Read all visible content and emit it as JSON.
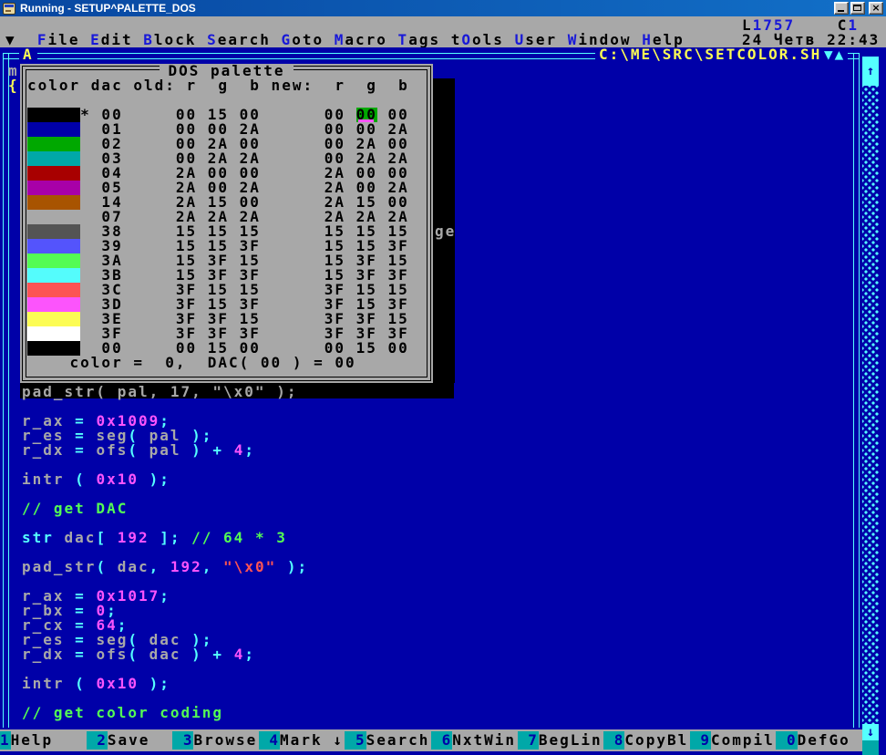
{
  "titlebar": {
    "title": "Running - SETUP^PALETTE_DOS"
  },
  "status": {
    "line1": [
      [
        "L",
        "k"
      ],
      [
        "1757",
        "b"
      ],
      [
        "    ",
        "k"
      ],
      [
        "C",
        "k"
      ],
      [
        "1",
        "b"
      ]
    ],
    "datetime": "24 Четв 22:43"
  },
  "menu": {
    "arrow": "▼",
    "items": [
      {
        "pre": "",
        "hot": "F",
        "post": "ile"
      },
      {
        "pre": "",
        "hot": "E",
        "post": "dit"
      },
      {
        "pre": "",
        "hot": "B",
        "post": "lock"
      },
      {
        "pre": "",
        "hot": "S",
        "post": "earch"
      },
      {
        "pre": "",
        "hot": "G",
        "post": "oto"
      },
      {
        "pre": "",
        "hot": "M",
        "post": "acro"
      },
      {
        "pre": "",
        "hot": "T",
        "post": "ags"
      },
      {
        "pre": "t",
        "hot": "O",
        "post": "ols"
      },
      {
        "pre": "",
        "hot": "U",
        "post": "ser"
      },
      {
        "pre": "",
        "hot": "W",
        "post": "indow"
      },
      {
        "pre": "",
        "hot": "H",
        "post": "elp"
      }
    ]
  },
  "editor": {
    "window_tag": "A",
    "file_path": "C:\\ME\\SRC\\SETCOLOR.SH",
    "collapse_icons": "▼▲",
    "scroll_up_icon": "↑",
    "scroll_down_icon": "↓",
    "fragment_left_1": "m",
    "fragment_left_2": "{",
    "fragment_shadow": "ge"
  },
  "dialog": {
    "title": "DOS palette",
    "header": "color dac old: r  g  b new:  r  g  b",
    "footer": "    color =  0,  DAC( 00 ) = 00",
    "rows": [
      {
        "swatch": "#000000",
        "marker": "*",
        "dac": "00",
        "old": [
          "00",
          "15",
          "00"
        ],
        "new": [
          "00",
          "00",
          "00"
        ],
        "hl": true
      },
      {
        "swatch": "#0000A8",
        "marker": "",
        "dac": "01",
        "old": [
          "00",
          "00",
          "2A"
        ],
        "new": [
          "00",
          "00",
          "2A"
        ]
      },
      {
        "swatch": "#00A800",
        "marker": "",
        "dac": "02",
        "old": [
          "00",
          "2A",
          "00"
        ],
        "new": [
          "00",
          "2A",
          "00"
        ]
      },
      {
        "swatch": "#00A8A8",
        "marker": "",
        "dac": "03",
        "old": [
          "00",
          "2A",
          "2A"
        ],
        "new": [
          "00",
          "2A",
          "2A"
        ]
      },
      {
        "swatch": "#A80000",
        "marker": "",
        "dac": "04",
        "old": [
          "2A",
          "00",
          "00"
        ],
        "new": [
          "2A",
          "00",
          "00"
        ]
      },
      {
        "swatch": "#A800A8",
        "marker": "",
        "dac": "05",
        "old": [
          "2A",
          "00",
          "2A"
        ],
        "new": [
          "2A",
          "00",
          "2A"
        ]
      },
      {
        "swatch": "#A85400",
        "marker": "",
        "dac": "14",
        "old": [
          "2A",
          "15",
          "00"
        ],
        "new": [
          "2A",
          "15",
          "00"
        ]
      },
      {
        "swatch": "#A8A8A8",
        "marker": "",
        "dac": "07",
        "old": [
          "2A",
          "2A",
          "2A"
        ],
        "new": [
          "2A",
          "2A",
          "2A"
        ]
      },
      {
        "swatch": "#545454",
        "marker": "",
        "dac": "38",
        "old": [
          "15",
          "15",
          "15"
        ],
        "new": [
          "15",
          "15",
          "15"
        ]
      },
      {
        "swatch": "#5454FC",
        "marker": "",
        "dac": "39",
        "old": [
          "15",
          "15",
          "3F"
        ],
        "new": [
          "15",
          "15",
          "3F"
        ]
      },
      {
        "swatch": "#54FC54",
        "marker": "",
        "dac": "3A",
        "old": [
          "15",
          "3F",
          "15"
        ],
        "new": [
          "15",
          "3F",
          "15"
        ]
      },
      {
        "swatch": "#54FCFC",
        "marker": "",
        "dac": "3B",
        "old": [
          "15",
          "3F",
          "3F"
        ],
        "new": [
          "15",
          "3F",
          "3F"
        ]
      },
      {
        "swatch": "#FC5454",
        "marker": "",
        "dac": "3C",
        "old": [
          "3F",
          "15",
          "15"
        ],
        "new": [
          "3F",
          "15",
          "15"
        ]
      },
      {
        "swatch": "#FC54FC",
        "marker": "",
        "dac": "3D",
        "old": [
          "3F",
          "15",
          "3F"
        ],
        "new": [
          "3F",
          "15",
          "3F"
        ]
      },
      {
        "swatch": "#FCFC54",
        "marker": "",
        "dac": "3E",
        "old": [
          "3F",
          "3F",
          "15"
        ],
        "new": [
          "3F",
          "3F",
          "15"
        ]
      },
      {
        "swatch": "#FFFFFF",
        "marker": "",
        "dac": "3F",
        "old": [
          "3F",
          "3F",
          "3F"
        ],
        "new": [
          "3F",
          "3F",
          "3F"
        ]
      },
      {
        "swatch": "#000000",
        "marker": "",
        "dac": "00",
        "old": [
          "00",
          "15",
          "00"
        ],
        "new": [
          "00",
          "15",
          "00"
        ]
      }
    ]
  },
  "code": {
    "lines": [
      {
        "marked": true,
        "tokens": [
          [
            "pad_str( pal, 17, \"\\x0\" );",
            "m"
          ]
        ]
      },
      {
        "tokens": []
      },
      {
        "tokens": [
          [
            "r_ax ",
            "i"
          ],
          [
            "= ",
            "o"
          ],
          [
            "0x1009",
            "n"
          ],
          [
            ";",
            "o"
          ]
        ]
      },
      {
        "tokens": [
          [
            "r_es ",
            "i"
          ],
          [
            "= ",
            "o"
          ],
          [
            "seg",
            "i"
          ],
          [
            "( ",
            "o"
          ],
          [
            "pal",
            "i"
          ],
          [
            " );",
            "o"
          ]
        ]
      },
      {
        "tokens": [
          [
            "r_dx ",
            "i"
          ],
          [
            "= ",
            "o"
          ],
          [
            "ofs",
            "i"
          ],
          [
            "( ",
            "o"
          ],
          [
            "pal",
            "i"
          ],
          [
            " ) + ",
            "o"
          ],
          [
            "4",
            "n"
          ],
          [
            ";",
            "o"
          ]
        ]
      },
      {
        "tokens": []
      },
      {
        "tokens": [
          [
            "intr ",
            "i"
          ],
          [
            "( ",
            "o"
          ],
          [
            "0x10",
            "n"
          ],
          [
            " );",
            "o"
          ]
        ]
      },
      {
        "tokens": []
      },
      {
        "tokens": [
          [
            "// get DAC",
            "c"
          ]
        ]
      },
      {
        "tokens": []
      },
      {
        "tokens": [
          [
            "str",
            "o"
          ],
          [
            " dac",
            "i"
          ],
          [
            "[ ",
            "o"
          ],
          [
            "192",
            "n"
          ],
          [
            " ]; ",
            "o"
          ],
          [
            "// 64 * 3",
            "c"
          ]
        ]
      },
      {
        "tokens": []
      },
      {
        "tokens": [
          [
            "pad_str",
            "i"
          ],
          [
            "( ",
            "o"
          ],
          [
            "dac",
            "i"
          ],
          [
            ", ",
            "o"
          ],
          [
            "192",
            "n"
          ],
          [
            ", ",
            "o"
          ],
          [
            "\"\\x0\"",
            "s"
          ],
          [
            " );",
            "o"
          ]
        ]
      },
      {
        "tokens": []
      },
      {
        "tokens": [
          [
            "r_ax ",
            "i"
          ],
          [
            "= ",
            "o"
          ],
          [
            "0x1017",
            "n"
          ],
          [
            ";",
            "o"
          ]
        ]
      },
      {
        "tokens": [
          [
            "r_bx ",
            "i"
          ],
          [
            "= ",
            "o"
          ],
          [
            "0",
            "n"
          ],
          [
            ";",
            "o"
          ]
        ]
      },
      {
        "tokens": [
          [
            "r_cx ",
            "i"
          ],
          [
            "= ",
            "o"
          ],
          [
            "64",
            "n"
          ],
          [
            ";",
            "o"
          ]
        ]
      },
      {
        "tokens": [
          [
            "r_es ",
            "i"
          ],
          [
            "= ",
            "o"
          ],
          [
            "seg",
            "i"
          ],
          [
            "( ",
            "o"
          ],
          [
            "dac",
            "i"
          ],
          [
            " );",
            "o"
          ]
        ]
      },
      {
        "tokens": [
          [
            "r_dx ",
            "i"
          ],
          [
            "= ",
            "o"
          ],
          [
            "ofs",
            "i"
          ],
          [
            "( ",
            "o"
          ],
          [
            "dac",
            "i"
          ],
          [
            " ) + ",
            "o"
          ],
          [
            "4",
            "n"
          ],
          [
            ";",
            "o"
          ]
        ]
      },
      {
        "tokens": []
      },
      {
        "tokens": [
          [
            "intr ",
            "i"
          ],
          [
            "( ",
            "o"
          ],
          [
            "0x10",
            "n"
          ],
          [
            " );",
            "o"
          ]
        ]
      },
      {
        "tokens": []
      },
      {
        "tokens": [
          [
            "// get color coding",
            "c"
          ]
        ]
      }
    ]
  },
  "fnbar": {
    "keys": [
      {
        "num": "1",
        "label": "Help"
      },
      {
        "num": "2",
        "label": "Save"
      },
      {
        "num": "3",
        "label": "Browse"
      },
      {
        "num": "4",
        "label": "Mark ↓"
      },
      {
        "num": "5",
        "label": "Search"
      },
      {
        "num": "6",
        "label": "NxtWin"
      },
      {
        "num": "7",
        "label": "BegLin"
      },
      {
        "num": "8",
        "label": "CopyBl"
      },
      {
        "num": "9",
        "label": "Compil"
      },
      {
        "num": "0",
        "label": "DefGo"
      }
    ]
  },
  "colors": {
    "dos_blue": "#0000A8",
    "dos_gray": "#A8A8A8",
    "bright_cyan": "#55FFFF",
    "teal": "#00A8A8",
    "hotkey_blue": "#1818D8",
    "number_magenta": "#FC54FC",
    "string_red": "#FC5454",
    "comment_green": "#54FC54",
    "highlight_green": "#00A800",
    "path_yellow": "#FCFC54"
  }
}
